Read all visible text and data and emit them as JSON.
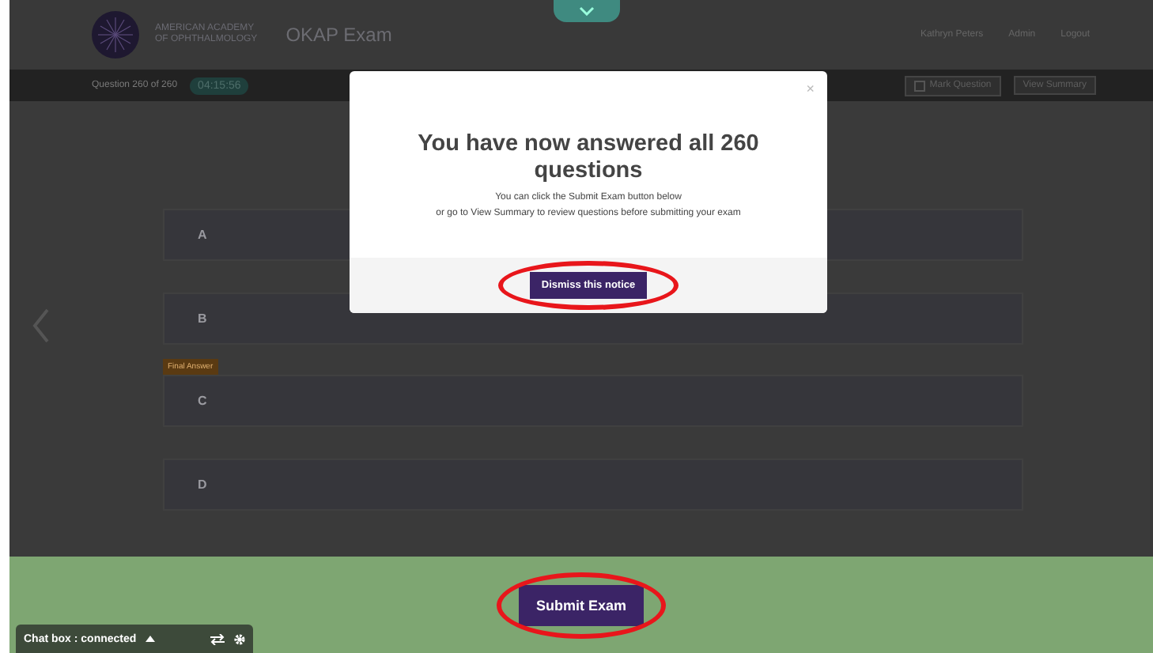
{
  "header": {
    "org_name": "AMERICAN ACADEMY\nOF OPHTHALMOLOGY",
    "app_title": "OKAP Exam",
    "user": "Kathryn Peters",
    "links": [
      "Admin",
      "Logout"
    ]
  },
  "exam_bar": {
    "progress": "Question 260 of 260",
    "timer": "04:15:56",
    "buttons": [
      {
        "label": "Mark Question",
        "kind": "checkbox",
        "checked": false
      },
      {
        "label": "View Summary",
        "kind": "plain"
      }
    ]
  },
  "answers": [
    {
      "letter": "A"
    },
    {
      "letter": "B"
    },
    {
      "letter": "C",
      "tag": "Final Answer"
    },
    {
      "letter": "D"
    }
  ],
  "modal": {
    "close": "×",
    "title": "You have now answered all 260 questions",
    "lines": [
      "You can click the Submit Exam button below",
      "or go to View Summary to review questions before submitting your exam"
    ],
    "button": "Dismiss this notice"
  },
  "footer": {
    "submit": "Submit Exam"
  },
  "chat": {
    "label": "Chat box : connected"
  }
}
